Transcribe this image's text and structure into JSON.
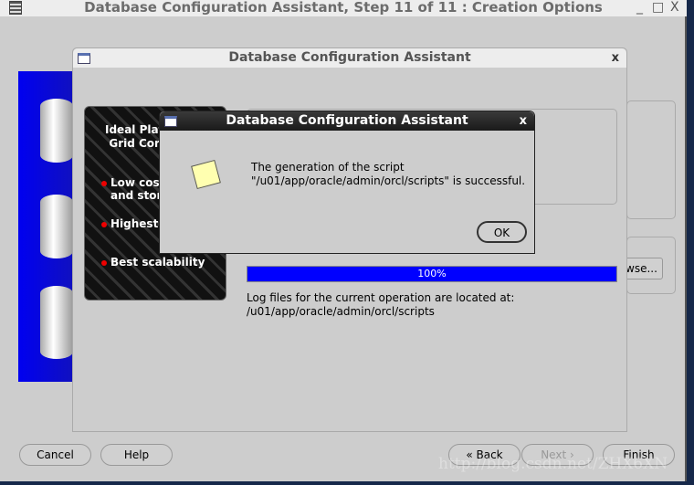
{
  "main_window": {
    "title": "Database Configuration Assistant, Step 11 of 11 : Creation Options",
    "controls": {
      "minimize": "_",
      "maximize": "□",
      "close": "X"
    }
  },
  "progress_dialog": {
    "title": "Database Configuration Assistant",
    "close": "x",
    "progress_percent": 100,
    "progress_label": "100%",
    "log_label": "Log files for the current operation are located at:",
    "log_path": "/u01/app/oracle/admin/orcl/scripts"
  },
  "promo_panel": {
    "heading_line1": "Ideal Plat",
    "heading_line2": "Grid Cor",
    "bullets": [
      "Low cost",
      "and stora",
      "Highest a",
      "Best scalability"
    ]
  },
  "message_dialog": {
    "title": "Database Configuration Assistant",
    "close": "x",
    "icon": "note-icon",
    "message_line1": "The generation of the script",
    "message_line2": "\"/u01/app/oracle/admin/orcl/scripts\" is successful.",
    "ok_label": "OK"
  },
  "background": {
    "browse_label": "wse..."
  },
  "footer": {
    "cancel_label": "Cancel",
    "help_label": "Help",
    "back_label": "Back",
    "next_label": "Next",
    "finish_label": "Finish"
  },
  "watermark": "http://blog.csdn.net/ZHX6XN"
}
